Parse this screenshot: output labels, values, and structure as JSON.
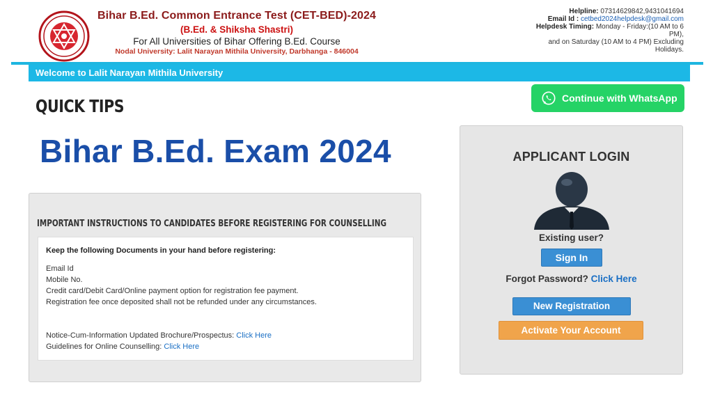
{
  "header": {
    "title": "Bihar B.Ed. Common Entrance Test (CET-BED)-2024",
    "subtitle": "(B.Ed. & Shiksha Shastri)",
    "tagline": "For All Universities of Bihar Offering B.Ed. Course",
    "nodal": "Nodal University: Lalit Narayan Mithila University, Darbhanga - 846004",
    "helpline_label": "Helpline:",
    "helpline_value": "07314629842,9431041694",
    "email_label": "Email Id :",
    "email_value": "cetbed2024helpdesk@gmail.com",
    "timing_label": "Helpdesk Timing:",
    "timing_value_1": "Monday - Friday:(10 AM to 6 PM),",
    "timing_value_2": "and on Saturday (10 AM to 4 PM) Excluding Holidays."
  },
  "welcome_text": "Welcome to Lalit Narayan Mithila University",
  "quick_tips": "QUICK TIPS",
  "whatsapp_label": "Continue with WhatsApp",
  "big_title": "Bihar B.Ed. Exam 2024",
  "instructions": {
    "title": "IMPORTANT INSTRUCTIONS TO CANDIDATES BEFORE REGISTERING FOR COUNSELLING",
    "keep": "Keep the following Documents in your hand before registering:",
    "items": [
      "Email Id",
      "Mobile No.",
      "Credit card/Debit Card/Online payment option for registration fee payment.",
      "Registration fee once deposited shall not be refunded under any circumstances."
    ],
    "notice_label": "Notice-Cum-Information Updated Brochure/Prospectus:",
    "notice_link": "Click Here",
    "guidelines_label": "Guidelines for Online Counselling:",
    "guidelines_link": "Click Here"
  },
  "login": {
    "title": "APPLICANT LOGIN",
    "existing": "Existing user?",
    "signin": "Sign In",
    "forgot_label": "Forgot Password?",
    "forgot_link": "Click Here",
    "new_registration": "New Registration",
    "activate": "Activate Your Account"
  },
  "colors": {
    "welcome_bar": "#1cb8e6",
    "whatsapp": "#25d366",
    "big_title": "#1a4ea8",
    "button_blue": "#3a8fd4",
    "button_orange": "#f0a44b"
  }
}
